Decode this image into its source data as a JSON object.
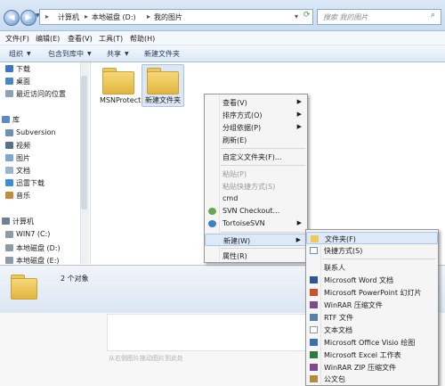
{
  "address_bar": {
    "breadcrumbs": [
      "计算机",
      "本地磁盘 (D:)",
      "我的图片"
    ],
    "search_placeholder": "搜索 我的图片"
  },
  "menu_bar": [
    "文件(F)",
    "编辑(E)",
    "查看(V)",
    "工具(T)",
    "帮助(H)"
  ],
  "toolbar": {
    "organize": "组织",
    "include_in_library": "包含到库中",
    "share": "共享",
    "new_folder": "新建文件夹"
  },
  "nav_pane": {
    "favorites": [
      "下载",
      "桌面",
      "最近访问的位置"
    ],
    "libraries_header": "库",
    "libraries": [
      "Subversion",
      "视频",
      "图片",
      "文档",
      "迅雷下载",
      "音乐"
    ],
    "computer_header": "计算机",
    "drives": [
      "WIN7 (C:)",
      "本地磁盘 (D:)",
      "本地磁盘 (E:)"
    ]
  },
  "files": [
    {
      "name": "MSNProtect"
    },
    {
      "name": "新建文件夹"
    }
  ],
  "status": {
    "count": "2 个对象"
  },
  "context_menu": {
    "items": [
      "查看(V)",
      "排序方式(O)",
      "分组依据(P)",
      "刷新(E)",
      "自定义文件夹(F)...",
      "粘贴(P)",
      "粘贴快捷方式(S)",
      "cmd",
      "SVN Checkout...",
      "TortoiseSVN",
      "新建(W)",
      "属性(R)"
    ]
  },
  "new_submenu": {
    "items": [
      "文件夹(F)",
      "快捷方式(S)",
      "联系人",
      "Microsoft Word 文档",
      "Microsoft PowerPoint 幻灯片",
      "WinRAR 压缩文件",
      "RTF 文件",
      "文本文档",
      "Microsoft Office Visio 绘图",
      "Microsoft Excel 工作表",
      "WinRAR ZIP 压缩文件",
      "公文包"
    ]
  },
  "background": {
    "hint": "从右侧图片拖动图片到此处"
  },
  "colors": {
    "highlight": "#dde9f7",
    "folder": "#f0c95a",
    "accent": "#4d7cb3"
  }
}
